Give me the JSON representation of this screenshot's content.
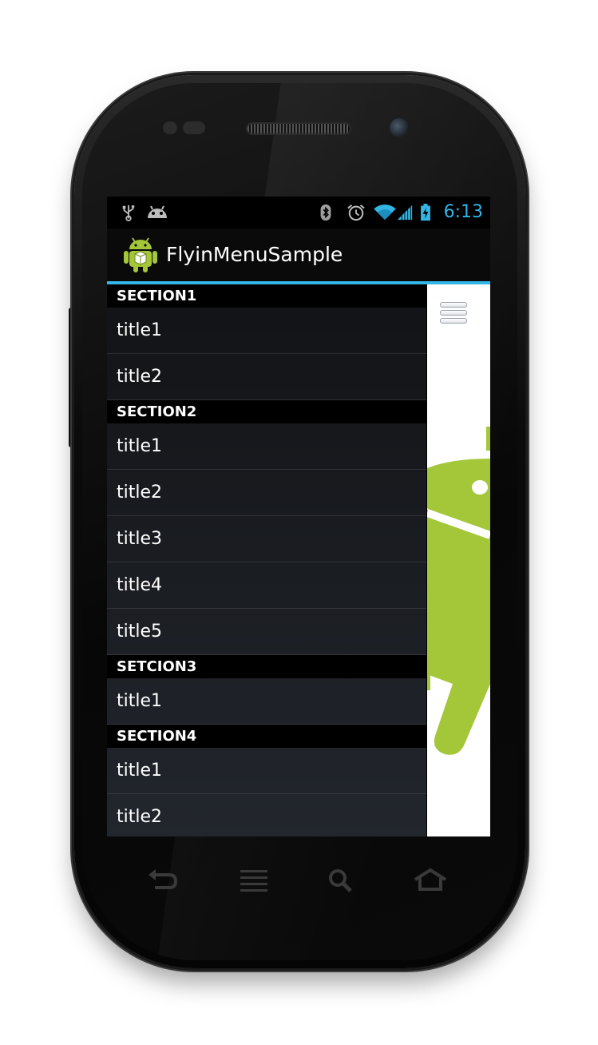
{
  "status_bar": {
    "left_icons": [
      "usb-icon",
      "android-debug-icon"
    ],
    "right_icons": [
      "bluetooth-icon",
      "alarm-icon",
      "wifi-icon",
      "signal-icon",
      "battery-charging-icon"
    ],
    "time": "6:13"
  },
  "action_bar": {
    "icon": "android-app-icon",
    "title": "FlyinMenuSample"
  },
  "menu": {
    "sections": [
      {
        "header": "SECTION1",
        "items": [
          "title1",
          "title2"
        ]
      },
      {
        "header": "SECTION2",
        "items": [
          "title1",
          "title2",
          "title3",
          "title4",
          "title5"
        ]
      },
      {
        "header": "SETCION3",
        "items": [
          "title1"
        ]
      },
      {
        "header": "SECTION4",
        "items": [
          "title1",
          "title2"
        ]
      }
    ]
  },
  "content": {
    "toggle_icon": "menu-icon",
    "image": "android-robot"
  },
  "nav_bar": {
    "buttons": [
      "back-icon",
      "menu-icon",
      "search-icon",
      "home-icon"
    ]
  },
  "colors": {
    "accent": "#33b5e5",
    "android_green": "#a4c639"
  }
}
